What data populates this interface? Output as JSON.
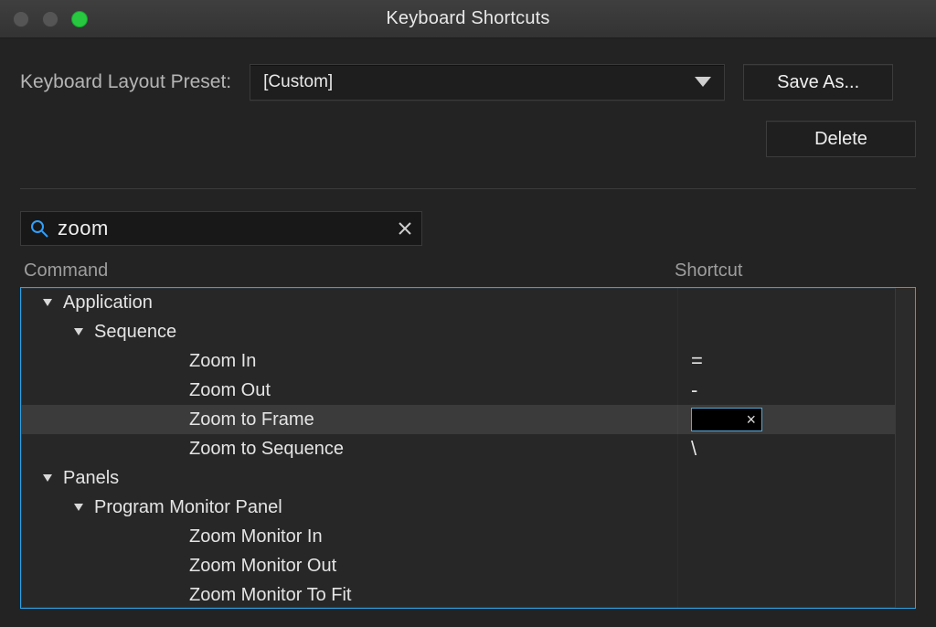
{
  "window": {
    "title": "Keyboard Shortcuts"
  },
  "preset": {
    "label": "Keyboard Layout Preset:",
    "value": "[Custom]"
  },
  "buttons": {
    "save_as": "Save As...",
    "delete": "Delete"
  },
  "search": {
    "value": "zoom"
  },
  "table": {
    "cols": {
      "command": "Command",
      "shortcut": "Shortcut"
    },
    "rows": [
      {
        "kind": "group",
        "level": 0,
        "label": "Application",
        "shortcut": ""
      },
      {
        "kind": "group",
        "level": 1,
        "label": "Sequence",
        "shortcut": ""
      },
      {
        "kind": "item",
        "level": 2,
        "label": "Zoom In",
        "shortcut": "="
      },
      {
        "kind": "item",
        "level": 2,
        "label": "Zoom Out",
        "shortcut": "-"
      },
      {
        "kind": "item",
        "level": 2,
        "label": "Zoom to Frame",
        "shortcut": "",
        "selected": true,
        "editing": true
      },
      {
        "kind": "item",
        "level": 2,
        "label": "Zoom to Sequence",
        "shortcut": "\\"
      },
      {
        "kind": "group",
        "level": 0,
        "label": "Panels",
        "shortcut": ""
      },
      {
        "kind": "group",
        "level": 1,
        "label": "Program Monitor Panel",
        "shortcut": ""
      },
      {
        "kind": "item",
        "level": 2,
        "label": "Zoom Monitor In",
        "shortcut": ""
      },
      {
        "kind": "item",
        "level": 2,
        "label": "Zoom Monitor Out",
        "shortcut": ""
      },
      {
        "kind": "item",
        "level": 2,
        "label": "Zoom Monitor To Fit",
        "shortcut": ""
      }
    ]
  }
}
